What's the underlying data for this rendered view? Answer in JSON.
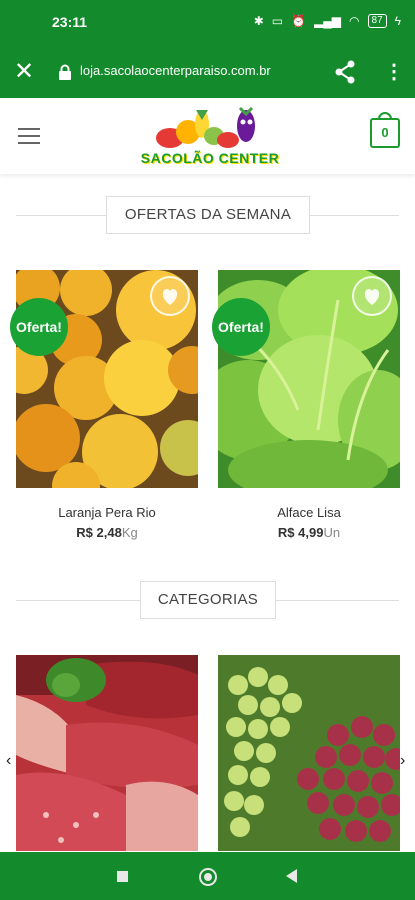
{
  "status_bar": {
    "time": "23:11",
    "battery": "87",
    "icons": [
      "bluetooth-icon",
      "vibrate-icon",
      "alarm-icon",
      "signal-icon",
      "signal-icon",
      "wifi-icon",
      "battery-icon",
      "charging-icon"
    ]
  },
  "browser": {
    "url": "loja.sacolaocenterparaiso.com.br",
    "close_icon": "close-icon",
    "lock_icon": "lock-icon",
    "share_icon": "share-icon",
    "menu_icon": "more-vert-icon"
  },
  "header": {
    "logo_text": "SACOLÃO CENTER",
    "cart_count": "0"
  },
  "offers": {
    "title": "OFERTAS DA SEMANA",
    "badge": "Oferta!",
    "products": [
      {
        "name": "Laranja Pera Rio",
        "currency": "R$",
        "price": "2,48",
        "unit": "Kg"
      },
      {
        "name": "Alface Lisa",
        "currency": "R$",
        "price": "4,99",
        "unit": "Un"
      }
    ]
  },
  "categories": {
    "title": "CATEGORIAS"
  },
  "colors": {
    "brand_green": "#138a2c",
    "badge_green": "#1aa334"
  }
}
